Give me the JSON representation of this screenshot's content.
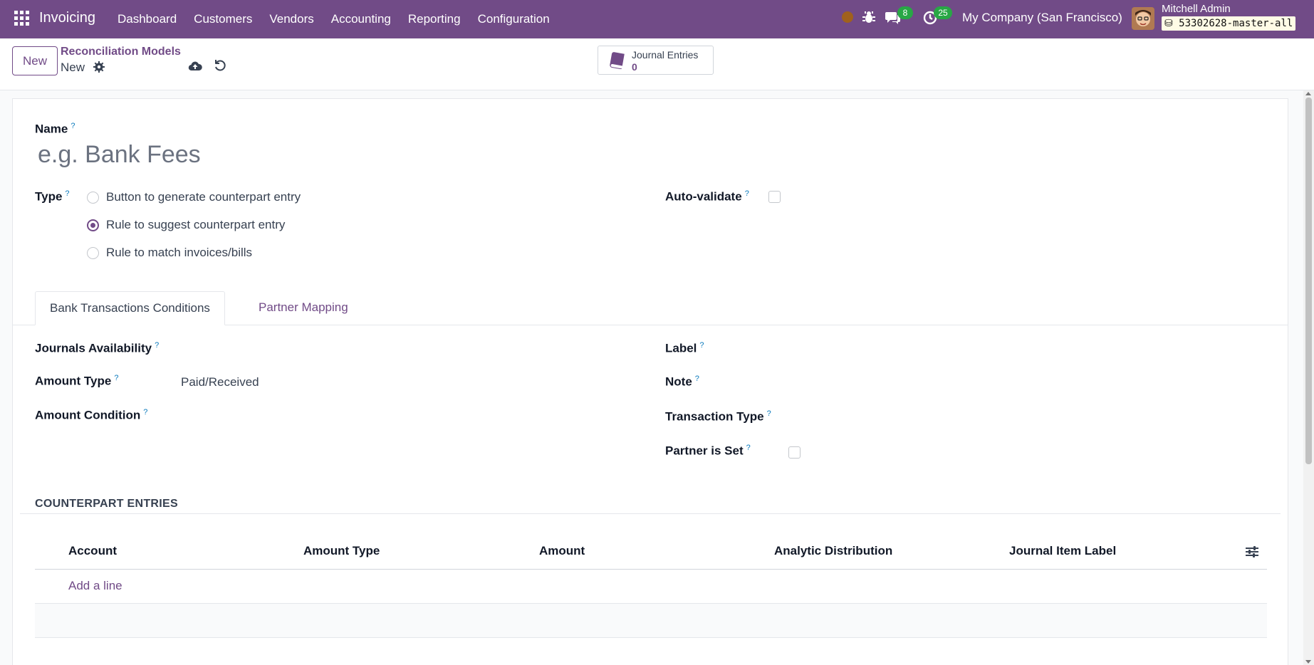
{
  "navbar": {
    "app_name": "Invoicing",
    "menu": [
      "Dashboard",
      "Customers",
      "Vendors",
      "Accounting",
      "Reporting",
      "Configuration"
    ],
    "messages_count": "8",
    "activities_count": "25",
    "company": "My Company (San Francisco)",
    "user_name": "Mitchell Admin",
    "database": "53302628-master-all",
    "brand_color": "#714b87"
  },
  "control_panel": {
    "new_label": "New",
    "breadcrumb_parent": "Reconciliation Models",
    "breadcrumb_current": "New",
    "smart_button": {
      "label": "Journal Entries",
      "value": "0"
    }
  },
  "form": {
    "name_label": "Name",
    "name_placeholder": "e.g. Bank Fees",
    "type_label": "Type",
    "type_options": [
      {
        "label": "Button to generate counterpart entry",
        "checked": false
      },
      {
        "label": "Rule to suggest counterpart entry",
        "checked": true
      },
      {
        "label": "Rule to match invoices/bills",
        "checked": false
      }
    ],
    "auto_validate_label": "Auto-validate",
    "auto_validate_checked": false,
    "help_mark": "?"
  },
  "tabs": [
    "Bank Transactions Conditions",
    "Partner Mapping"
  ],
  "conditions": {
    "journals_availability_label": "Journals Availability",
    "amount_type_label": "Amount Type",
    "amount_type_value": "Paid/Received",
    "amount_condition_label": "Amount Condition",
    "label_label": "Label",
    "note_label": "Note",
    "transaction_type_label": "Transaction Type",
    "partner_is_set_label": "Partner is Set",
    "partner_is_set_checked": false
  },
  "counterpart": {
    "title": "COUNTERPART ENTRIES",
    "columns": [
      "Account",
      "Amount Type",
      "Amount",
      "Analytic Distribution",
      "Journal Item Label"
    ],
    "add_line": "Add a line"
  }
}
